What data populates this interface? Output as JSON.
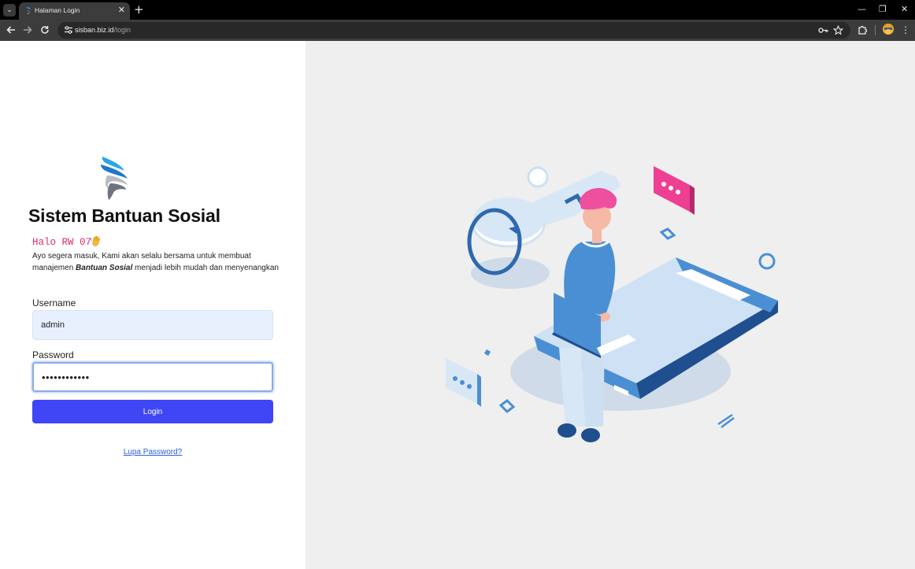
{
  "browser": {
    "tab_title": "Halaman Login",
    "tab_close": "✕",
    "new_tab": "+",
    "url_host": "sisban.biz.id",
    "url_path": "/login",
    "window_minimize": "—",
    "window_restore": "❐",
    "window_close": "✕"
  },
  "login": {
    "app_title": "Sistem Bantuan Sosial",
    "greeting": "Halo RW 07",
    "intro_before": "Ayo segera masuk, Kami akan selalu bersama untuk membuat manajemen ",
    "intro_emphasis": "Bantuan Sosial",
    "intro_after": " menjadi lebih mudah dan menyenangkan",
    "username_label": "Username",
    "username_value": "admin",
    "password_label": "Password",
    "password_value": "adminadmin12",
    "login_button": "Login",
    "forgot_link": "Lupa Password?"
  },
  "colors": {
    "primary_button": "#3f46f5",
    "greeting": "#dd2968",
    "illustration_background": "#efefef",
    "accent_pink": "#ef3f93",
    "accent_blue": "#4a8fd3"
  },
  "icons": {
    "tab_search": "chevron-down-icon",
    "back": "arrow-left-icon",
    "forward": "arrow-right-icon",
    "reload": "reload-icon",
    "site_info": "tune-icon",
    "password_key": "key-icon",
    "bookmark": "star-icon",
    "extensions": "puzzle-icon",
    "wave": "waving-hand-icon"
  }
}
